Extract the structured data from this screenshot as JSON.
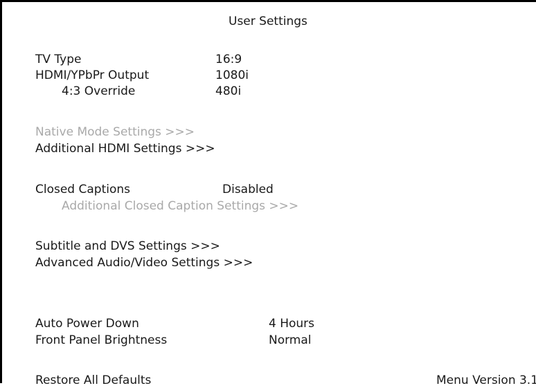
{
  "title": "User Settings",
  "colors": {
    "text": "#1a1a1a",
    "disabled_text": "#a9a9a9",
    "background": "#ffffff",
    "frame": "#000000"
  },
  "settings": {
    "tv_type": {
      "label": "TV Type",
      "value": "16:9"
    },
    "hdmi_output": {
      "label": "HDMI/YPbPr Output",
      "value": "1080i"
    },
    "override_43": {
      "label": "4:3 Override",
      "value": "480i"
    },
    "native_mode": {
      "label": "Native Mode Settings >>>",
      "enabled": false
    },
    "additional_hdmi": {
      "label": "Additional HDMI Settings >>>",
      "enabled": true
    },
    "closed_captions": {
      "label": "Closed Captions",
      "value": "Disabled"
    },
    "additional_cc": {
      "label": "Additional Closed Caption Settings >>>",
      "enabled": false
    },
    "subtitle_dvs": {
      "label": "Subtitle and DVS Settings >>>",
      "enabled": true
    },
    "advanced_av": {
      "label": "Advanced Audio/Video Settings >>>",
      "enabled": true
    },
    "auto_power_down": {
      "label": "Auto Power Down",
      "value": "4 Hours"
    },
    "front_panel": {
      "label": "Front Panel Brightness",
      "value": "Normal"
    },
    "restore_defaults": {
      "label": "Restore All Defaults"
    }
  },
  "footer": {
    "menu_version": "Menu Version 3.1"
  }
}
